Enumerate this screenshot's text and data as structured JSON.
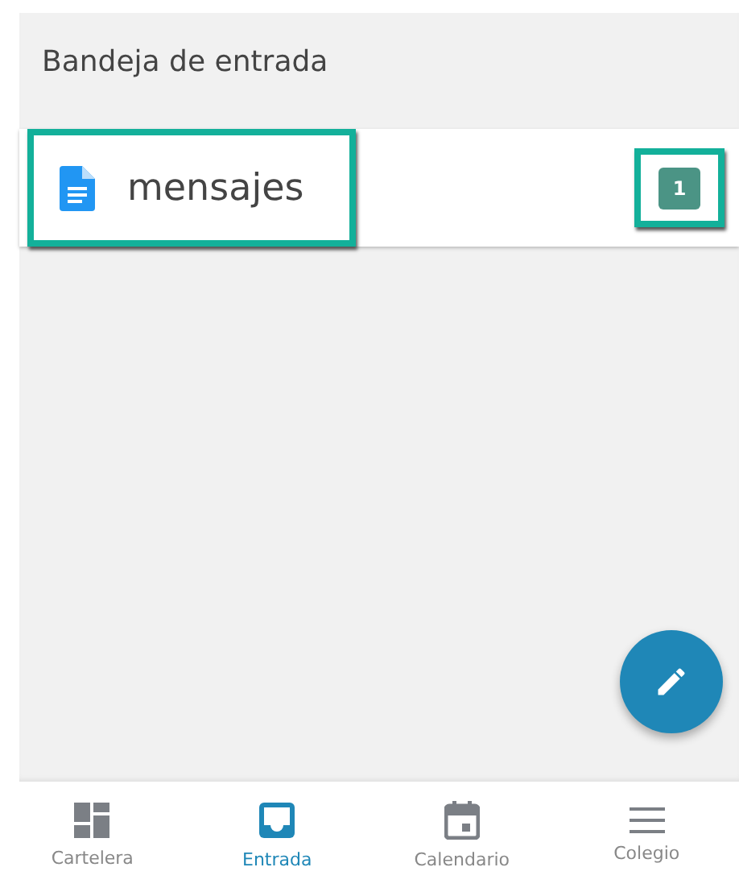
{
  "header": {
    "title": "Bandeja de entrada"
  },
  "folders": [
    {
      "label": "mensajes",
      "count": "1",
      "highlighted": true,
      "count_highlighted": true
    }
  ],
  "fab": {
    "kind": "edit"
  },
  "nav": [
    {
      "kind": "dashboard",
      "label": "Cartelera",
      "selected": false
    },
    {
      "kind": "inbox",
      "label": "Entrada",
      "selected": true
    },
    {
      "kind": "calendar",
      "label": "Calendario",
      "selected": false
    },
    {
      "kind": "menu",
      "label": "Colegio",
      "selected": false
    }
  ]
}
